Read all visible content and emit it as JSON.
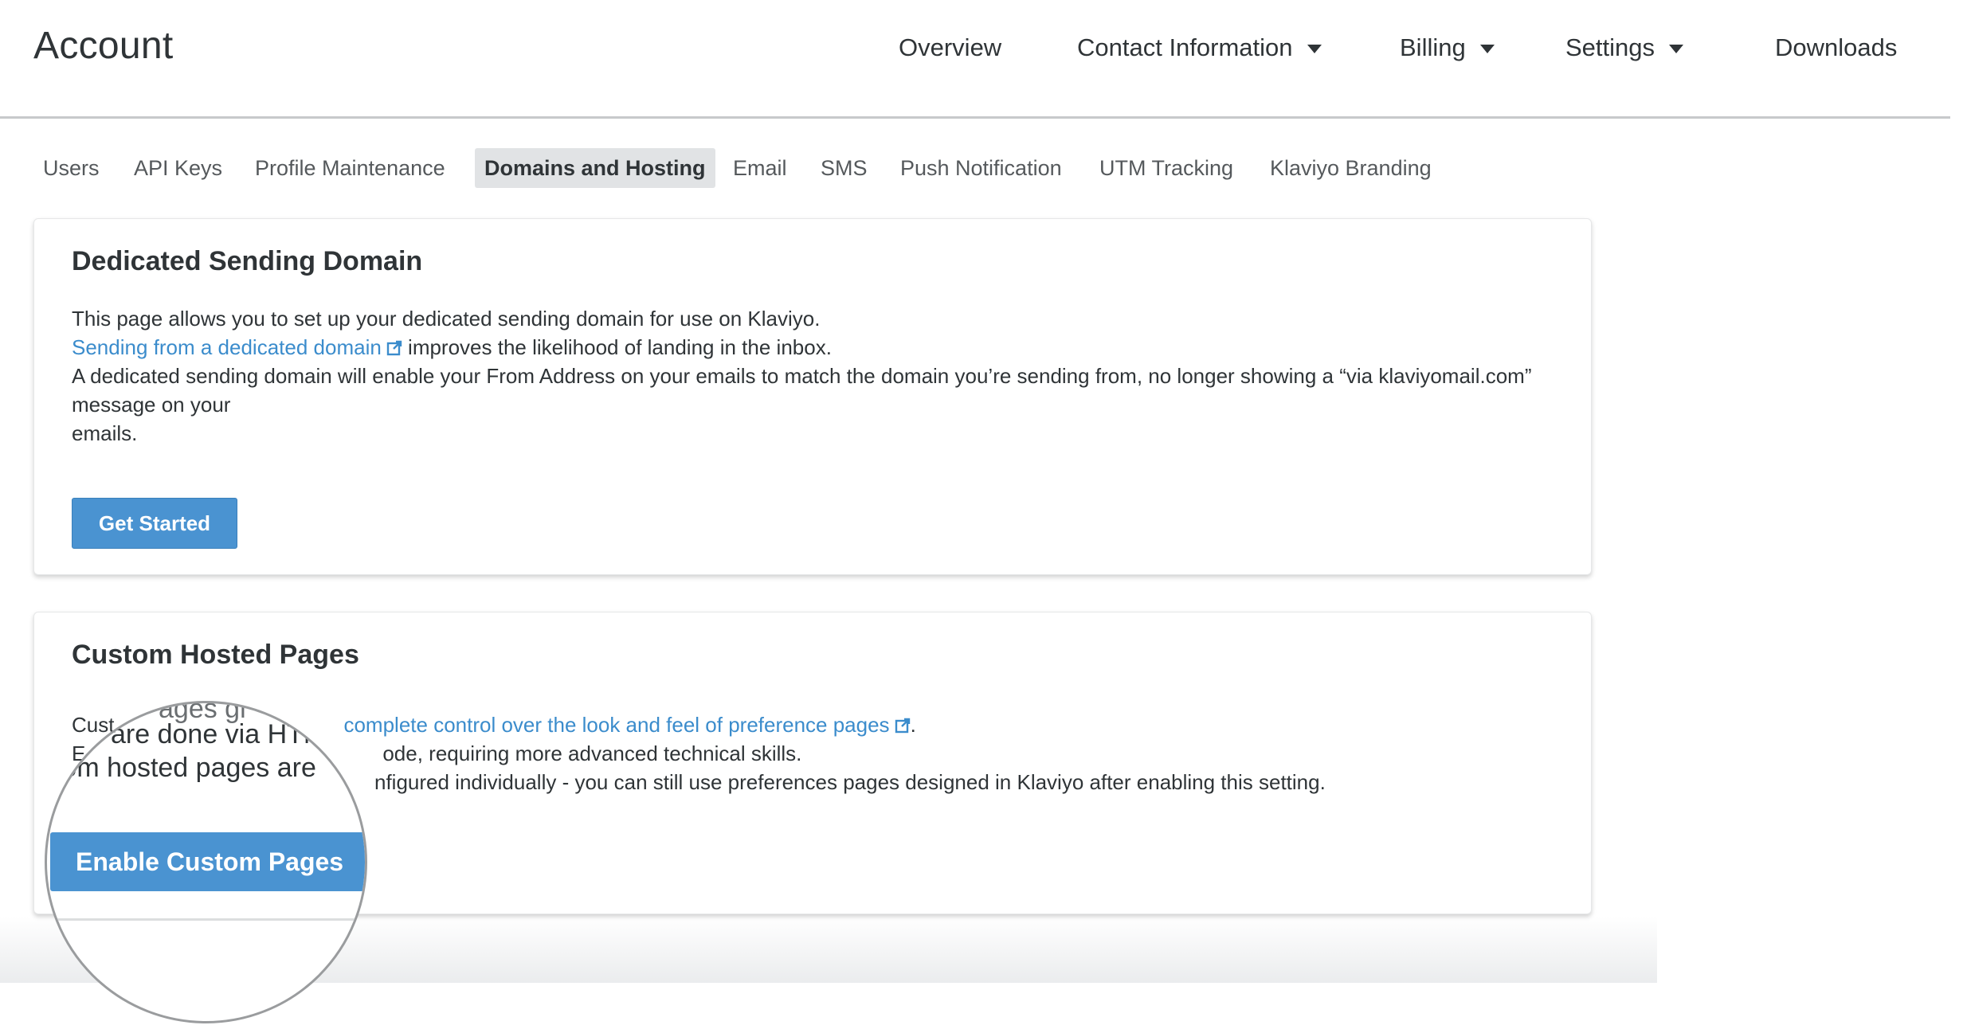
{
  "header": {
    "title": "Account",
    "nav": [
      {
        "label": "Overview",
        "has_dropdown": false
      },
      {
        "label": "Contact Information",
        "has_dropdown": true
      },
      {
        "label": "Billing",
        "has_dropdown": true
      },
      {
        "label": "Settings",
        "has_dropdown": true
      },
      {
        "label": "Downloads",
        "has_dropdown": false
      }
    ]
  },
  "subnav": {
    "tabs": [
      {
        "label": "Users"
      },
      {
        "label": "API Keys"
      },
      {
        "label": "Profile Maintenance"
      },
      {
        "label": "Domains and Hosting",
        "active": true
      },
      {
        "label": "Email"
      },
      {
        "label": "SMS"
      },
      {
        "label": "Push Notification"
      },
      {
        "label": "UTM Tracking"
      },
      {
        "label": "Klaviyo Branding"
      }
    ]
  },
  "sending_domain": {
    "title": "Dedicated Sending Domain",
    "line1": "This page allows you to set up your dedicated sending domain for use on Klaviyo.",
    "link_text": "Sending from a dedicated domain",
    "line2_rest": " improves the likelihood of landing in the inbox.",
    "line3": "A dedicated sending domain will enable your From Address on your emails to match the domain you’re sending from, no longer showing a “via klaviyomail.com” message on your",
    "line4": "emails.",
    "button_label": "Get Started"
  },
  "custom_pages": {
    "title": "Custom Hosted Pages",
    "line1_start": "Cust",
    "line1_link": "complete control over the look and feel of preference pages",
    "line1_end": ".",
    "line2_start": "E",
    "line2_rest": "ode, requiring more advanced technical skills.",
    "line3_rest": "nfigured individually - you can still use preferences pages designed in Klaviyo after enabling this setting.",
    "button_label": "Enable Custom Pages"
  },
  "magnifier": {
    "partial_top": "ages gi",
    "line_a": "are done via HTM",
    "line_b": "stom hosted pages are",
    "button_label": "Enable Custom Pages"
  },
  "colors": {
    "accent": "#4a93d1",
    "link": "#3b8ccc",
    "text": "#2f3437",
    "active_tab_bg": "#e1e3e5"
  },
  "icons": {
    "external_link": "external-link-icon",
    "dropdown": "caret-down-icon"
  }
}
